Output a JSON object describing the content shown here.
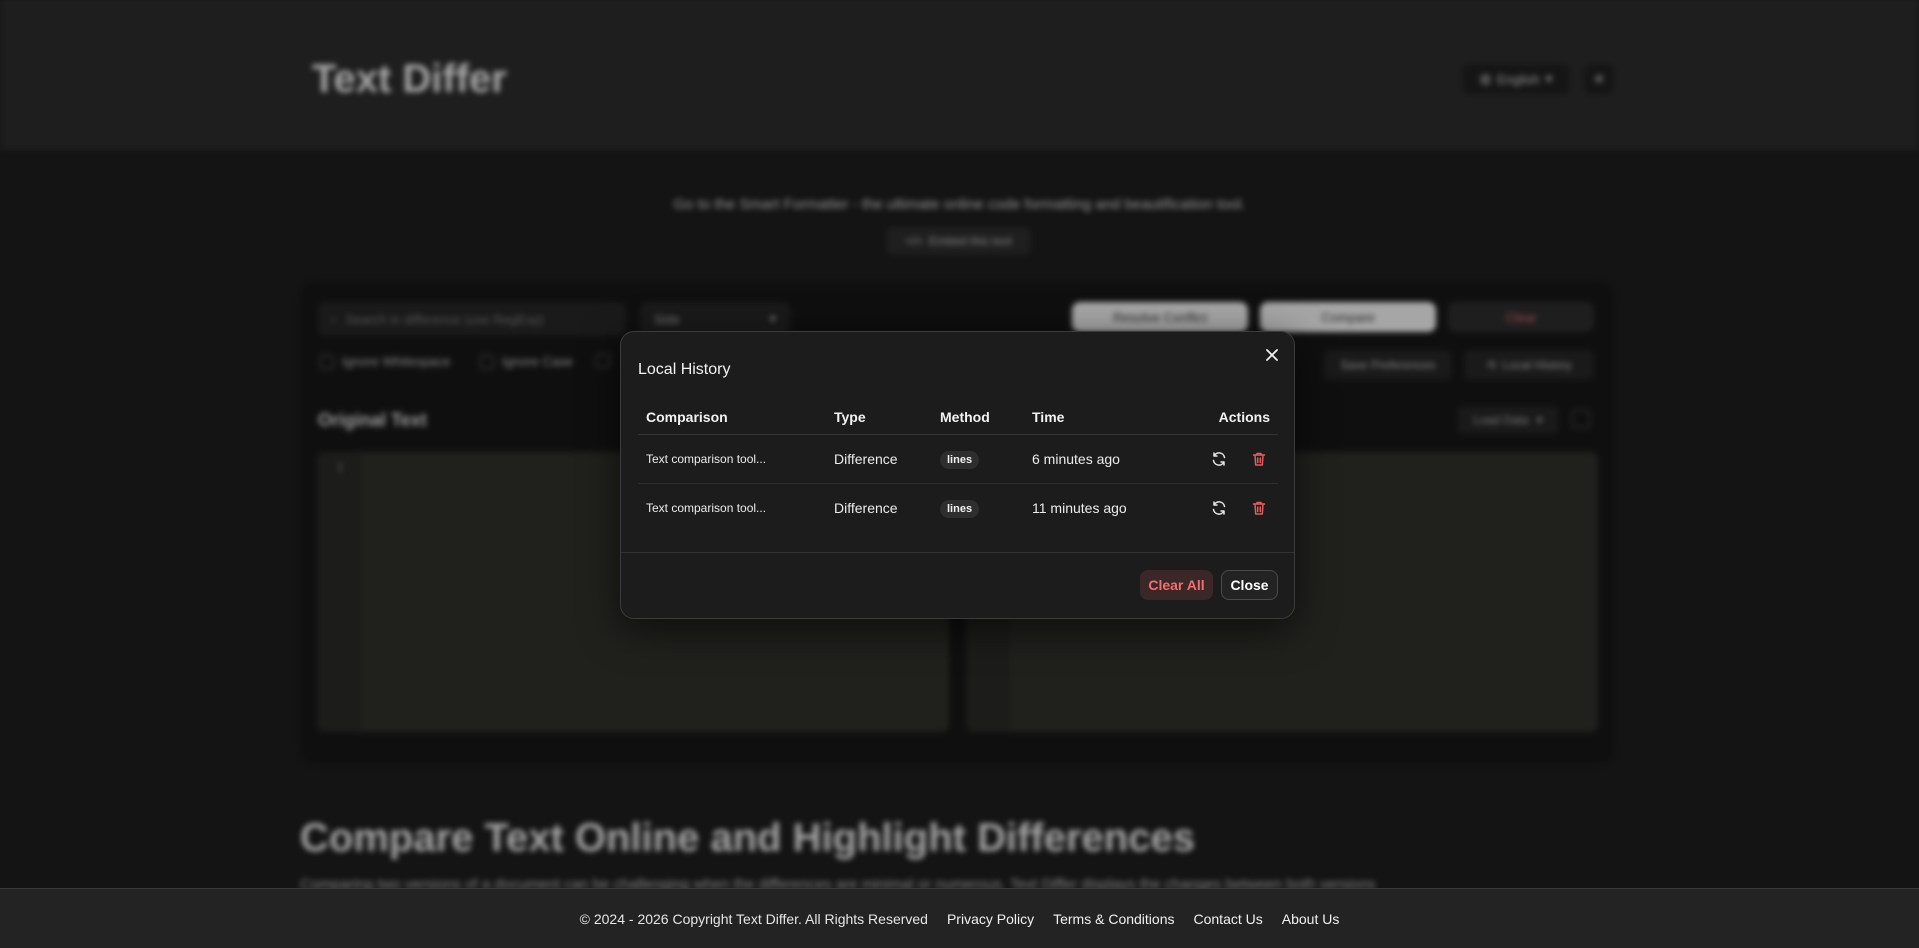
{
  "colors": {
    "accent_danger": "#f07070",
    "modal_bg": "#1c1c1c",
    "page_bg": "#1c1c1c"
  },
  "header": {
    "title": "Text Differ",
    "language": "English",
    "globe_icon": "globe-icon",
    "theme_icon": "sun-icon"
  },
  "promo": {
    "text": "Go to the Smart Formatter - the ultimate online code formatting and beautification tool.",
    "embed_label": "Embed this tool"
  },
  "toolbar": {
    "search_placeholder": "Search in difference (use RegExp)",
    "view_select": "Side",
    "resolve_conflict_label": "Resolve Conflict",
    "compare_label": "Compare",
    "clear_label": "Clear",
    "options": [
      "Ignore Whitespace",
      "Ignore Case"
    ],
    "save_preferences_label": "Save Preferences",
    "local_history_label": "Local History"
  },
  "editor": {
    "original_label": "Original Text",
    "load_data_label": "Load Data",
    "line_number": "1"
  },
  "section": {
    "heading": "Compare Text Online and Highlight Differences",
    "paragraph": "Comparing two versions of a document can be challenging when the differences are minimal or numerous. Text Differ displays the changes between both versions"
  },
  "modal": {
    "title": "Local History",
    "close_icon": "close-icon",
    "columns": [
      "Comparison",
      "Type",
      "Method",
      "Time",
      "Actions"
    ],
    "rows": [
      {
        "comparison": "Text comparison tool...",
        "type": "Difference",
        "method": "lines",
        "time": "6 minutes ago"
      },
      {
        "comparison": "Text comparison tool...",
        "type": "Difference",
        "method": "lines",
        "time": "11 minutes ago"
      }
    ],
    "clear_all_label": "Clear All",
    "close_label": "Close"
  },
  "footer": {
    "copyright": "© 2024 - 2026 Copyright Text Differ. All Rights Reserved",
    "links": [
      "Privacy Policy",
      "Terms & Conditions",
      "Contact Us",
      "About Us"
    ]
  }
}
